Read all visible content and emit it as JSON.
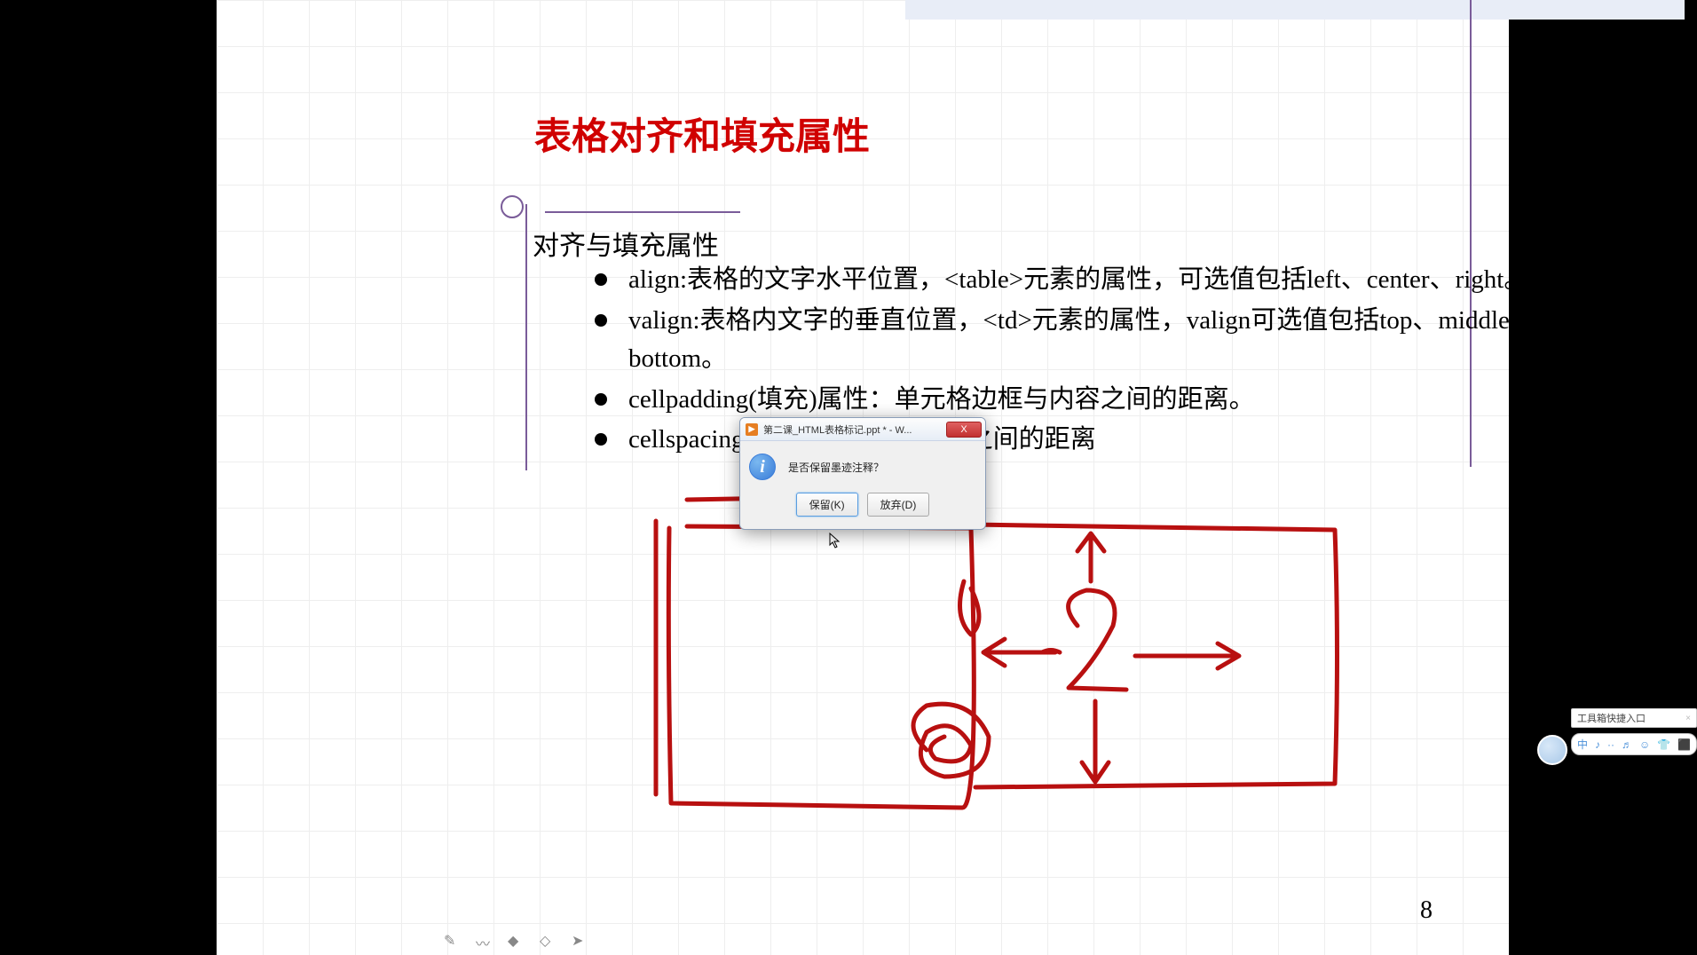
{
  "slide": {
    "title": "表格对齐和填充属性",
    "section_label": "对齐与填充属性",
    "bullets": [
      "align:表格的文字水平位置，<table>元素的属性，可选值包括left、center、right。",
      "valign:表格内文字的垂直位置，<td>元素的属性，valign可选值包括top、middle、bottom。",
      "cellpadding(填充)属性：单元格边框与内容之间的距离。",
      "cellspacing(间距)属性：单元格之间的距离"
    ],
    "page_number": "8"
  },
  "dialog": {
    "title": "第二课_HTML表格标记.ppt * - W...",
    "message": "是否保留墨迹注释？",
    "keep_label": "保留(K)",
    "discard_label": "放弃(D)",
    "close_symbol": "X"
  },
  "ime": {
    "label": "工具箱快捷入口",
    "close_symbol": "×",
    "items": [
      "中",
      "♪",
      "··",
      "♬",
      "☺",
      "👕",
      "⬛",
      "⊘"
    ]
  },
  "tools": {
    "pen": "✎",
    "wave": "〰",
    "highlighter": "◆",
    "eraser": "◇",
    "arrow": "➤"
  }
}
